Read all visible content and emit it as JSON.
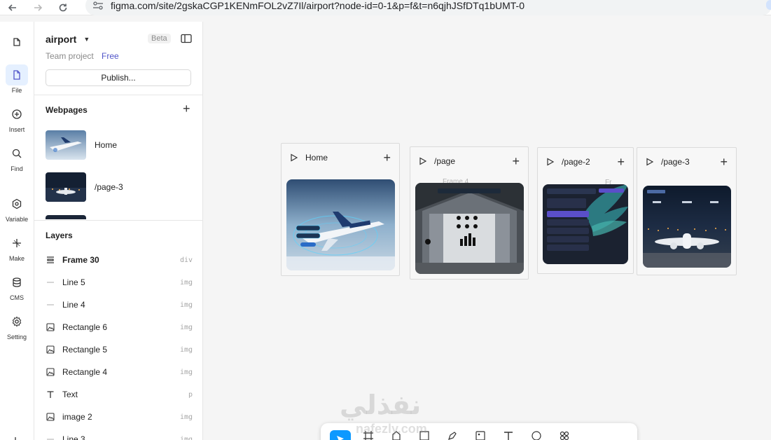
{
  "browser": {
    "url": "figma.com/site/2gskaCGP1KENmFOL2vZ7Il/airport?node-id=0-1&p=f&t=n6qjhJSfDTq1bUMT-0"
  },
  "rail": {
    "items": [
      {
        "label": "File",
        "icon": "file-icon"
      },
      {
        "label": "Insert",
        "icon": "insert-icon"
      },
      {
        "label": "Find",
        "icon": "search-icon"
      },
      {
        "label": "Variable",
        "icon": "variable-icon"
      },
      {
        "label": "Make",
        "icon": "make-icon"
      },
      {
        "label": "CMS",
        "icon": "database-icon"
      },
      {
        "label": "Setting",
        "icon": "gear-icon"
      }
    ]
  },
  "panel": {
    "project_name": "airport",
    "beta": "Beta",
    "team": "Team project",
    "plan": "Free",
    "publish_label": "Publish...",
    "webpages_title": "Webpages",
    "webpages": [
      {
        "label": "Home"
      },
      {
        "label": "/page-3"
      }
    ],
    "layers_title": "Layers",
    "layers": [
      {
        "label": "Frame 30",
        "type": "div",
        "icon": "frame-icon"
      },
      {
        "label": "Line 5",
        "type": "img",
        "icon": "line-icon"
      },
      {
        "label": "Line 4",
        "type": "img",
        "icon": "line-icon"
      },
      {
        "label": "Rectangle 6",
        "type": "img",
        "icon": "image-icon"
      },
      {
        "label": "Rectangle 5",
        "type": "img",
        "icon": "image-icon"
      },
      {
        "label": "Rectangle 4",
        "type": "img",
        "icon": "image-icon"
      },
      {
        "label": "Text",
        "type": "p",
        "icon": "text-icon"
      },
      {
        "label": "image 2",
        "type": "img",
        "icon": "image-icon"
      },
      {
        "label": "Line 3",
        "type": "img",
        "icon": "line-icon"
      }
    ]
  },
  "canvas": {
    "frames": [
      {
        "name": "Home"
      },
      {
        "name": "/page",
        "ghost": "Frame 4"
      },
      {
        "name": "/page-2",
        "ghost": "Fr"
      },
      {
        "name": "/page-3"
      }
    ]
  },
  "watermark": {
    "arabic": "نفذلي",
    "latin": "nafezly.com"
  },
  "colors": {
    "accent": "#0d99ff",
    "plan": "#5155c9",
    "active_rail": "#e5f0ff"
  }
}
